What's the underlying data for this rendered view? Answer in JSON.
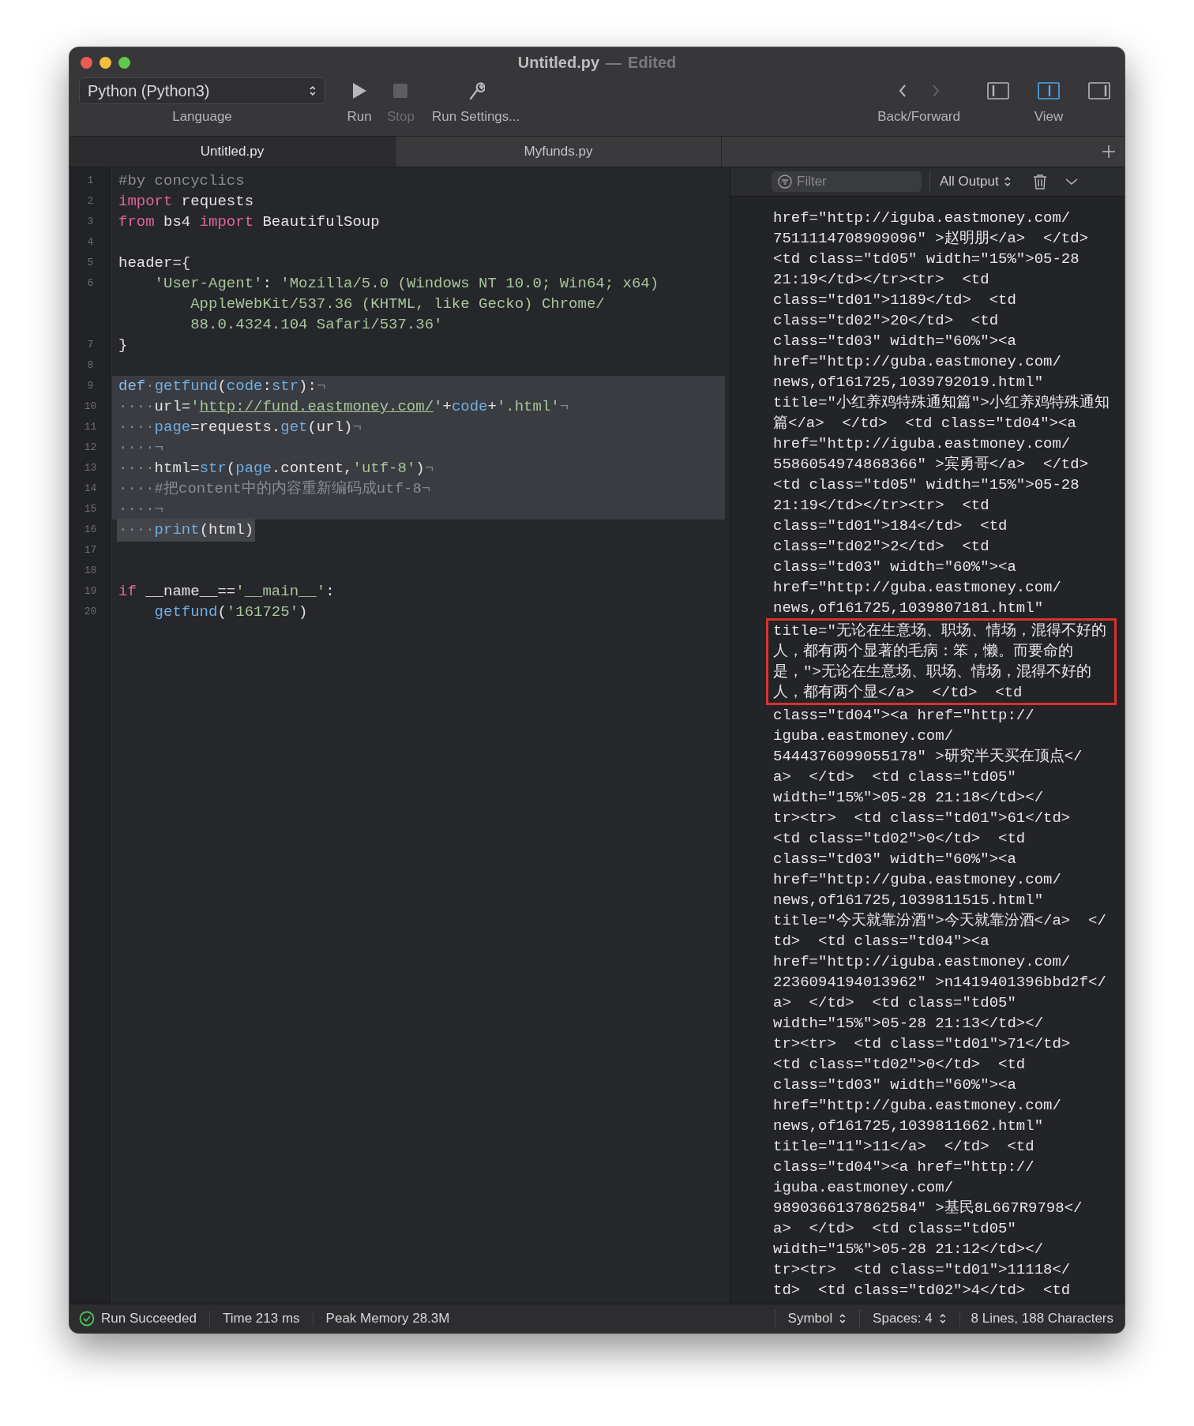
{
  "window": {
    "title": "Untitled.py",
    "separator": "—",
    "subtitle": "Edited"
  },
  "toolbar": {
    "language": {
      "value": "Python (Python3)",
      "label": "Language"
    },
    "run": {
      "label": "Run",
      "disabled": false
    },
    "stop": {
      "label": "Stop",
      "disabled": true
    },
    "run_settings": {
      "label": "Run Settings..."
    },
    "navigation": {
      "label": "Back/Forward",
      "back_disabled": false,
      "forward_disabled": true
    },
    "view": {
      "label": "View",
      "panes": [
        {
          "selected": false
        },
        {
          "selected": true
        },
        {
          "selected": false
        }
      ]
    }
  },
  "tabs": [
    {
      "label": "Untitled.py",
      "selected": true
    },
    {
      "label": "Myfunds.py",
      "selected": false
    }
  ],
  "editor": {
    "rows": [
      {
        "number": "1",
        "line_selected": false,
        "text_selected": false,
        "tokens": [
          {
            "kind": "comment",
            "text": "#by concyclics"
          }
        ]
      },
      {
        "number": "2",
        "line_selected": false,
        "text_selected": false,
        "tokens": [
          {
            "kind": "keyword",
            "text": "import"
          },
          {
            "kind": "plain",
            "text": " requests"
          }
        ]
      },
      {
        "number": "3",
        "line_selected": false,
        "text_selected": false,
        "tokens": [
          {
            "kind": "keyword",
            "text": "from"
          },
          {
            "kind": "plain",
            "text": " bs4 "
          },
          {
            "kind": "keyword",
            "text": "import"
          },
          {
            "kind": "plain",
            "text": " BeautifulSoup"
          }
        ]
      },
      {
        "number": "4",
        "line_selected": false,
        "text_selected": false,
        "tokens": []
      },
      {
        "number": "5",
        "line_selected": false,
        "text_selected": false,
        "tokens": [
          {
            "kind": "plain",
            "text": "header={"
          }
        ]
      },
      {
        "number": "6",
        "line_selected": false,
        "text_selected": false,
        "tokens": [
          {
            "kind": "string",
            "text": "    'User-Agent'"
          },
          {
            "kind": "plain",
            "text": ": "
          },
          {
            "kind": "string",
            "text": "'Mozilla/5.0 (Windows NT 10.0; Win64; x64)"
          }
        ]
      },
      {
        "line_selected": false,
        "text_selected": false,
        "tokens": [
          {
            "kind": "string",
            "text": "        AppleWebKit/537.36 (KHTML, like Gecko) Chrome/"
          }
        ]
      },
      {
        "line_selected": false,
        "text_selected": false,
        "tokens": [
          {
            "kind": "string",
            "text": "        88.0.4324.104 Safari/537.36'"
          }
        ]
      },
      {
        "number": "7",
        "line_selected": false,
        "text_selected": false,
        "tokens": [
          {
            "kind": "plain",
            "text": "}"
          }
        ]
      },
      {
        "number": "8",
        "line_selected": false,
        "text_selected": false,
        "tokens": []
      },
      {
        "number": "9",
        "line_selected": true,
        "text_selected": false,
        "tokens": [
          {
            "kind": "declaration",
            "text": "def"
          },
          {
            "kind": "invisible",
            "text": "·"
          },
          {
            "kind": "function",
            "text": "getfund"
          },
          {
            "kind": "plain",
            "text": "("
          },
          {
            "kind": "function",
            "text": "code"
          },
          {
            "kind": "plain",
            "text": ":"
          },
          {
            "kind": "function",
            "text": "str"
          },
          {
            "kind": "plain",
            "text": "):"
          },
          {
            "kind": "invisible",
            "text": "¬"
          }
        ]
      },
      {
        "number": "10",
        "line_selected": true,
        "text_selected": false,
        "tokens": [
          {
            "kind": "invisible",
            "text": "····"
          },
          {
            "kind": "plain",
            "text": "url="
          },
          {
            "kind": "string",
            "text": "'"
          },
          {
            "kind": "url",
            "text": "http://fund.eastmoney.com/"
          },
          {
            "kind": "string",
            "text": "'"
          },
          {
            "kind": "plain",
            "text": "+"
          },
          {
            "kind": "function",
            "text": "code"
          },
          {
            "kind": "plain",
            "text": "+"
          },
          {
            "kind": "string",
            "text": "'.html'"
          },
          {
            "kind": "invisible",
            "text": "¬"
          }
        ]
      },
      {
        "number": "11",
        "line_selected": true,
        "text_selected": false,
        "tokens": [
          {
            "kind": "invisible",
            "text": "····"
          },
          {
            "kind": "function",
            "text": "page"
          },
          {
            "kind": "plain",
            "text": "=requests."
          },
          {
            "kind": "function",
            "text": "get"
          },
          {
            "kind": "plain",
            "text": "(url)"
          },
          {
            "kind": "invisible",
            "text": "¬"
          }
        ]
      },
      {
        "number": "12",
        "line_selected": true,
        "text_selected": false,
        "tokens": [
          {
            "kind": "invisible",
            "text": "····¬"
          }
        ]
      },
      {
        "number": "13",
        "line_selected": true,
        "text_selected": false,
        "tokens": [
          {
            "kind": "invisible",
            "text": "····"
          },
          {
            "kind": "plain",
            "text": "html="
          },
          {
            "kind": "function",
            "text": "str"
          },
          {
            "kind": "plain",
            "text": "("
          },
          {
            "kind": "function",
            "text": "page"
          },
          {
            "kind": "plain",
            "text": ".content,"
          },
          {
            "kind": "string",
            "text": "'utf-8'"
          },
          {
            "kind": "plain",
            "text": ")"
          },
          {
            "kind": "invisible",
            "text": "¬"
          }
        ]
      },
      {
        "number": "14",
        "line_selected": true,
        "text_selected": false,
        "tokens": [
          {
            "kind": "invisible",
            "text": "····"
          },
          {
            "kind": "comment",
            "text": "#把content中的内容重新编码成utf-8"
          },
          {
            "kind": "invisible",
            "text": "¬"
          }
        ]
      },
      {
        "number": "15",
        "line_selected": true,
        "text_selected": false,
        "tokens": [
          {
            "kind": "invisible",
            "text": "····¬"
          }
        ]
      },
      {
        "number": "16",
        "line_selected": false,
        "text_selected": true,
        "tokens": [
          {
            "kind": "invisible",
            "text": "····"
          },
          {
            "kind": "function",
            "text": "print"
          },
          {
            "kind": "plain",
            "text": "(html)"
          }
        ]
      },
      {
        "number": "17",
        "line_selected": false,
        "text_selected": false,
        "tokens": []
      },
      {
        "number": "18",
        "line_selected": false,
        "text_selected": false,
        "tokens": []
      },
      {
        "number": "19",
        "line_selected": false,
        "text_selected": false,
        "tokens": [
          {
            "kind": "keyword",
            "text": "if"
          },
          {
            "kind": "plain",
            "text": " __name__=="
          },
          {
            "kind": "string",
            "text": "'__main__'"
          },
          {
            "kind": "plain",
            "text": ":"
          }
        ]
      },
      {
        "number": "20",
        "line_selected": false,
        "text_selected": false,
        "tokens": [
          {
            "kind": "function",
            "text": "    getfund"
          },
          {
            "kind": "plain",
            "text": "("
          },
          {
            "kind": "string",
            "text": "'161725'"
          },
          {
            "kind": "plain",
            "text": ")"
          }
        ]
      }
    ]
  },
  "output": {
    "filter": {
      "placeholder": "Filter"
    },
    "scope": "All Output",
    "blocks": [
      {
        "boxed": false,
        "lines": [
          "href=\"http://iguba.eastmoney.com/",
          "7511114708909096\" >赵明朋</a>  </td>",
          "<td class=\"td05\" width=\"15%\">05-28",
          "21:19</td></tr><tr>  <td",
          "class=\"td01\">1189</td>  <td",
          "class=\"td02\">20</td>  <td",
          "class=\"td03\" width=\"60%\"><a",
          "href=\"http://guba.eastmoney.com/",
          "news,of161725,1039792019.html\"",
          "title=\"小红养鸡特殊通知篇\">小红养鸡特殊通知",
          "篇</a>  </td>  <td class=\"td04\"><a",
          "href=\"http://iguba.eastmoney.com/",
          "5586054974868366\" >宾勇哥</a>  </td>",
          "<td class=\"td05\" width=\"15%\">05-28",
          "21:19</td></tr><tr>  <td",
          "class=\"td01\">184</td>  <td",
          "class=\"td02\">2</td>  <td",
          "class=\"td03\" width=\"60%\"><a",
          "href=\"http://guba.eastmoney.com/",
          "news,of161725,1039807181.html\""
        ]
      },
      {
        "boxed": true,
        "lines": [
          "title=\"无论在生意场、职场、情场，混得不好的",
          "人，都有两个显著的毛病：笨，懒。而要命的",
          "是，\">无论在生意场、职场、情场，混得不好的",
          "人，都有两个显</a>  </td>  <td"
        ]
      },
      {
        "boxed": false,
        "lines": [
          "class=\"td04\"><a href=\"http://",
          "iguba.eastmoney.com/",
          "5444376099055178\" >研究半天买在顶点</",
          "a>  </td>  <td class=\"td05\"",
          "width=\"15%\">05-28 21:18</td></",
          "tr><tr>  <td class=\"td01\">61</td>",
          "<td class=\"td02\">0</td>  <td",
          "class=\"td03\" width=\"60%\"><a",
          "href=\"http://guba.eastmoney.com/",
          "news,of161725,1039811515.html\"",
          "title=\"今天就靠汾酒\">今天就靠汾酒</a>  </",
          "td>  <td class=\"td04\"><a",
          "href=\"http://iguba.eastmoney.com/",
          "2236094194013962\" >n1419401396bbd2f</",
          "a>  </td>  <td class=\"td05\"",
          "width=\"15%\">05-28 21:13</td></",
          "tr><tr>  <td class=\"td01\">71</td>",
          "<td class=\"td02\">0</td>  <td",
          "class=\"td03\" width=\"60%\"><a",
          "href=\"http://guba.eastmoney.com/",
          "news,of161725,1039811662.html\"",
          "title=\"11\">11</a>  </td>  <td",
          "class=\"td04\"><a href=\"http://",
          "iguba.eastmoney.com/",
          "9890366137862584\" >基民8L667R9798</",
          "a>  </td>  <td class=\"td05\"",
          "width=\"15%\">05-28 21:12</td></",
          "tr><tr>  <td class=\"td01\">11118</",
          "td>  <td class=\"td02\">4</td>  <td"
        ]
      }
    ]
  },
  "status_bar": {
    "result": {
      "text": "Run Succeeded",
      "success": true
    },
    "time": "Time 213 ms",
    "memory": "Peak Memory 28.3M",
    "symbol": "Symbol",
    "spaces": "Spaces: 4",
    "counts": "8 Lines, 188 Characters"
  }
}
